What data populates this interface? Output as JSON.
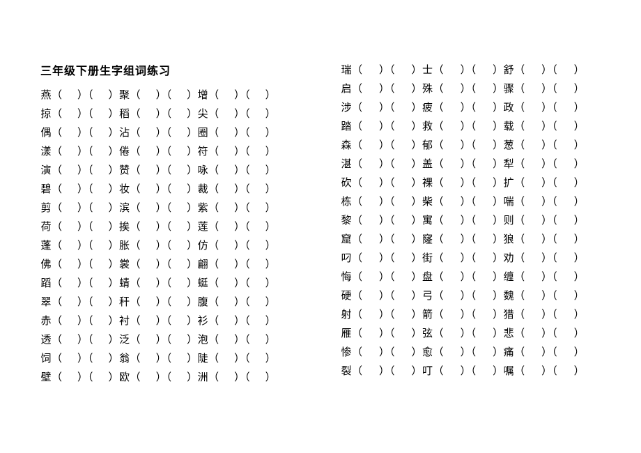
{
  "title": "三年级下册生字组词练习",
  "left_rows": [
    [
      "燕",
      "聚",
      "增"
    ],
    [
      "掠",
      "稻",
      "尖"
    ],
    [
      "偶",
      "沾",
      "圈"
    ],
    [
      "漾",
      "倦",
      "符"
    ],
    [
      "演",
      "赞",
      "咏"
    ],
    [
      "碧",
      "妆",
      "裁"
    ],
    [
      "剪",
      "滨",
      "紫"
    ],
    [
      "荷",
      "挨",
      "莲"
    ],
    [
      "蓬",
      "胀",
      "仿"
    ],
    [
      "佛",
      "裳",
      "翩"
    ],
    [
      "蹈",
      "蜻",
      "蜓"
    ],
    [
      "翠",
      "秆",
      "腹"
    ],
    [
      "赤",
      "衬",
      "衫"
    ],
    [
      "透",
      "泛",
      "泡"
    ],
    [
      "饲",
      "翁",
      "陡"
    ],
    [
      "壁",
      "欧",
      "洲"
    ]
  ],
  "right_special": [
    "瑞",
    "士",
    "舒"
  ],
  "right_rows": [
    [
      "启",
      "殊",
      "骤"
    ],
    [
      "涉",
      "疲",
      "政"
    ],
    [
      "踏",
      "救",
      "载"
    ],
    [
      "森",
      "郁",
      "葱"
    ],
    [
      "湛",
      "盖",
      "犁"
    ],
    [
      "砍",
      "裸",
      "扩"
    ],
    [
      "栋",
      "柴",
      "喘"
    ],
    [
      "黎",
      "寓",
      "则"
    ],
    [
      "窟",
      "窿",
      "狼"
    ],
    [
      "叼",
      "街",
      "劝"
    ],
    [
      "悔",
      "盘",
      "缠"
    ],
    [
      "硬",
      "弓",
      "魏"
    ],
    [
      "射",
      "箭",
      "猎"
    ],
    [
      "雁",
      "弦",
      "悲"
    ],
    [
      "惨",
      "愈",
      "痛"
    ],
    [
      "裂",
      "叮",
      "嘱"
    ]
  ]
}
